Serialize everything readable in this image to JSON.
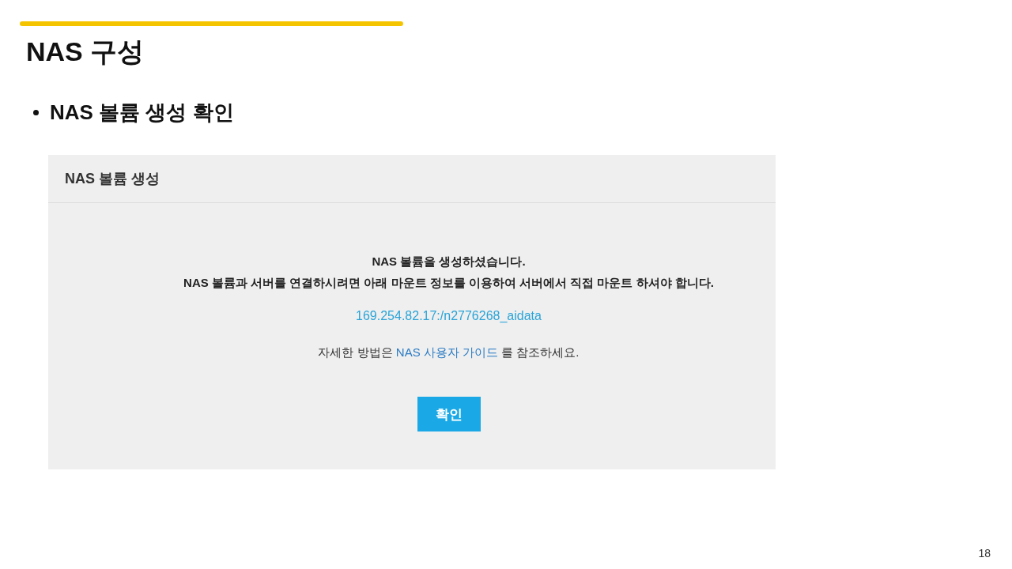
{
  "slide": {
    "title": "NAS 구성",
    "bullet": "NAS 볼륨 생성 확인",
    "page_number": "18"
  },
  "dialog": {
    "title": "NAS 볼륨 생성",
    "message_lines": [
      "NAS 볼륨을 생성하셨습니다.",
      "NAS 볼륨과 서버를 연결하시려면 아래 마운트 정보를 이용하여 서버에서 직접 마운트 하셔야 합니다."
    ],
    "mount_path": "169.254.82.17:/n2776268_aidata",
    "guide": {
      "before": "자세한 방법은",
      "link": "NAS 사용자 가이드",
      "after": "를 참조하세요."
    },
    "buttons": [
      "확인"
    ]
  }
}
